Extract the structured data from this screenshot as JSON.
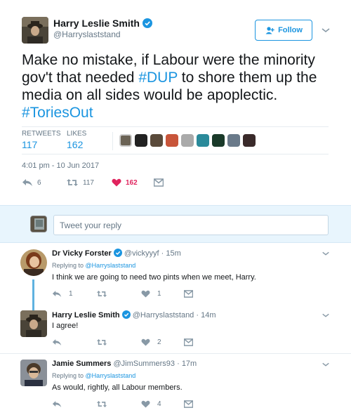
{
  "main_tweet": {
    "author_name": "Harry Leslie Smith",
    "author_handle": "@Harryslaststand",
    "follow_label": "Follow",
    "text_1": "Make no mistake, if Labour were the minority gov't that needed ",
    "hashtag_1": "#DUP",
    "text_2": " to shore them up the media on all sides would be apoplectic. ",
    "hashtag_2": "#ToriesOut",
    "retweets_label": "RETWEETS",
    "retweets_count": "117",
    "likes_label": "LIKES",
    "likes_count": "162",
    "timestamp": "4:01 pm - 10 Jun 2017",
    "reply_count": "6",
    "retweet_count": "117",
    "like_count": "162"
  },
  "reply_box": {
    "placeholder": "Tweet your reply"
  },
  "replies": [
    {
      "name": "Dr Vicky Forster",
      "handle": "@vickyyyf",
      "time": "15m",
      "replying_to_label": "Replying to",
      "replying_to": "@Harryslaststand",
      "text": "I think we are going to need two pints when we meet, Harry.",
      "reply_count": "1",
      "like_count": "1"
    },
    {
      "name": "Harry Leslie Smith",
      "handle": "@Harryslaststand",
      "time": "14m",
      "text": "I agree!",
      "like_count": "2"
    },
    {
      "name": "Jamie Summers",
      "handle": "@JimSummers93",
      "time": "17m",
      "replying_to_label": "Replying to",
      "replying_to": "@Harryslaststand",
      "text": "As would, rightly, all Labour members.",
      "like_count": "4"
    }
  ],
  "separator": " · ",
  "colors": {
    "accent": "#1b95e0",
    "like_red": "#e0245e",
    "gray": "#657786",
    "reply_bg": "#e8f5fd"
  },
  "icons": [
    "verified-icon",
    "follow-person-icon",
    "chevron-down-icon",
    "reply-icon",
    "retweet-icon",
    "heart-icon",
    "dm-icon"
  ]
}
